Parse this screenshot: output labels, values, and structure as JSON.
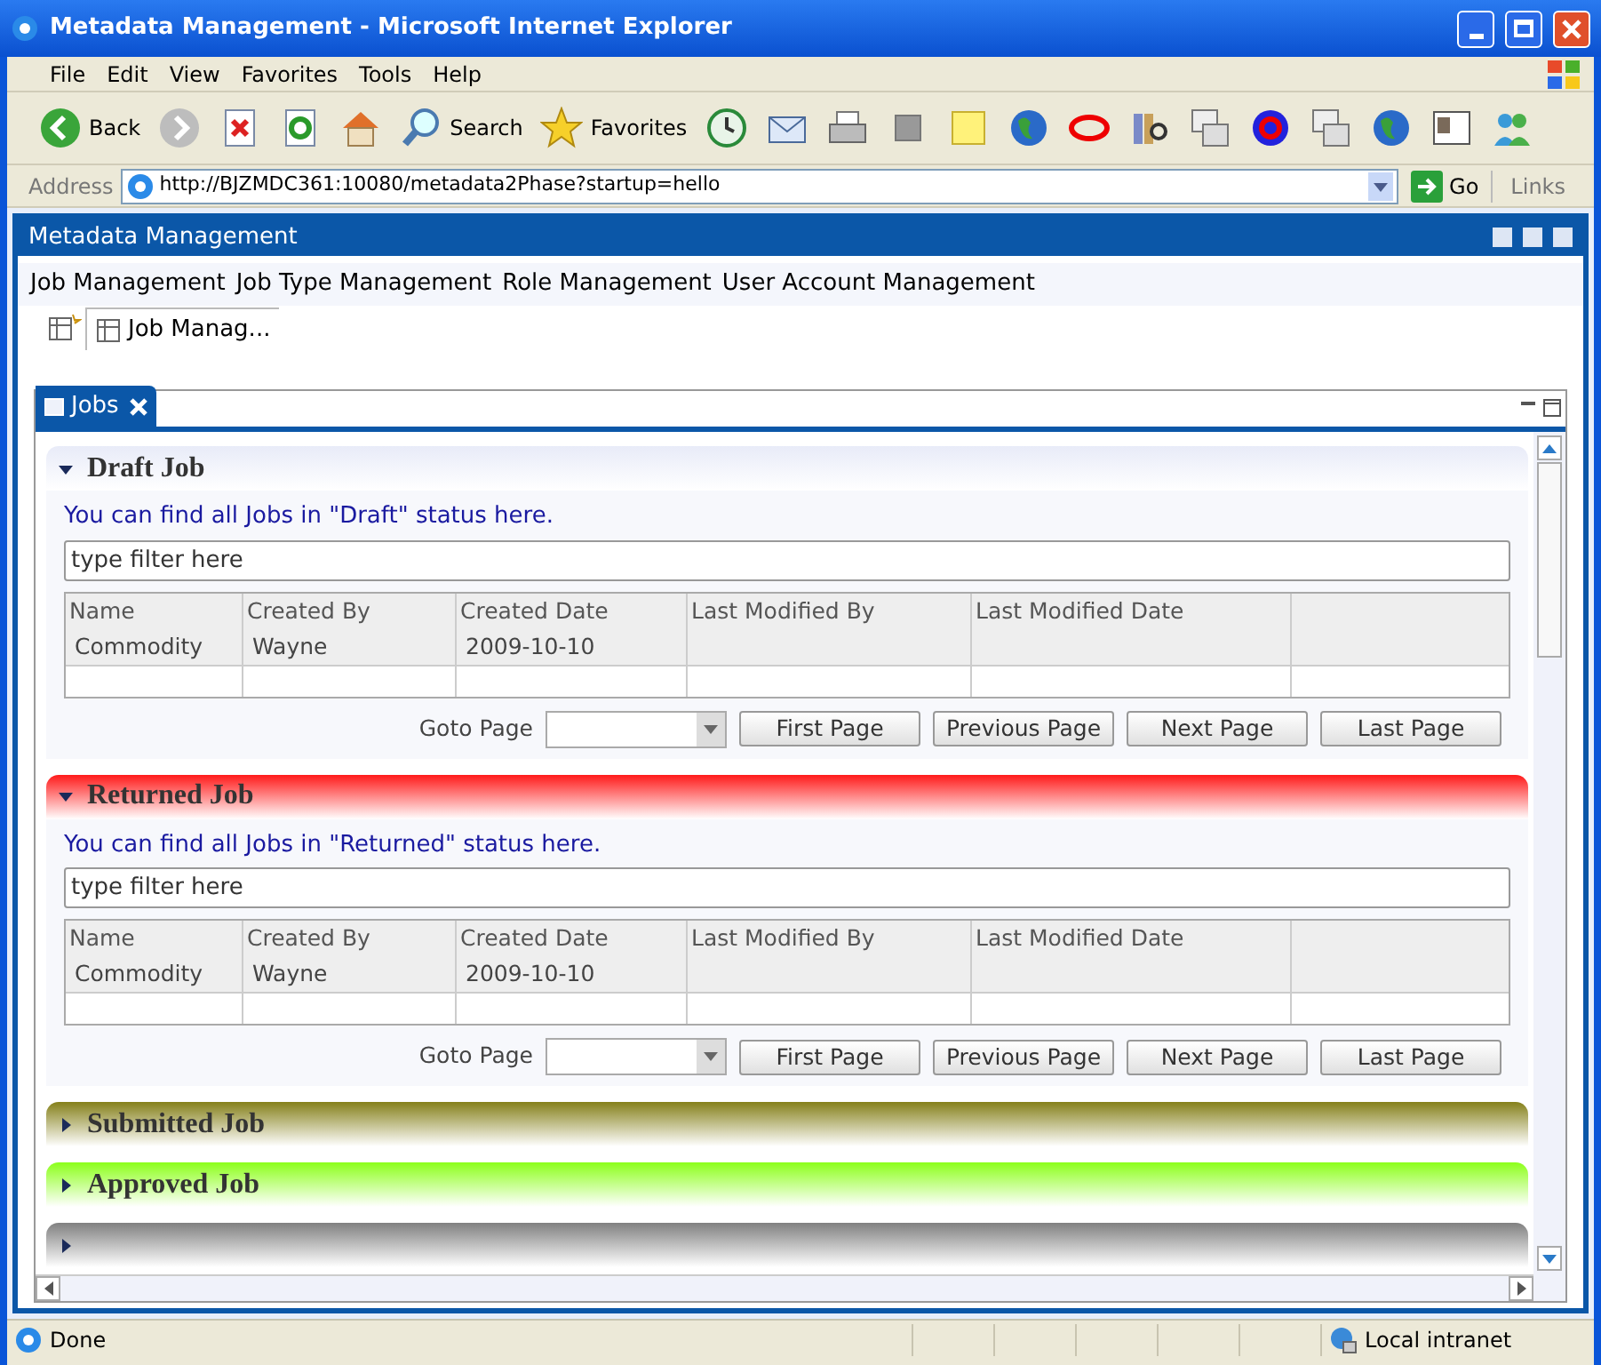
{
  "window": {
    "title": "Metadata Management - Microsoft Internet Explorer"
  },
  "menu": [
    "File",
    "Edit",
    "View",
    "Favorites",
    "Tools",
    "Help"
  ],
  "toolbar": [
    {
      "kind": "back",
      "label": "Back"
    },
    {
      "kind": "forward"
    },
    {
      "kind": "stop"
    },
    {
      "kind": "refresh"
    },
    {
      "kind": "home"
    },
    {
      "kind": "search",
      "label": "Search"
    },
    {
      "kind": "favorites",
      "label": "Favorites"
    },
    {
      "kind": "history"
    },
    {
      "kind": "mail"
    },
    {
      "kind": "print"
    },
    {
      "kind": "edit"
    },
    {
      "kind": "note"
    },
    {
      "kind": "globe"
    },
    {
      "kind": "ring"
    },
    {
      "kind": "books"
    },
    {
      "kind": "sort"
    },
    {
      "kind": "letter"
    },
    {
      "kind": "sort"
    },
    {
      "kind": "globe"
    },
    {
      "kind": "card"
    },
    {
      "kind": "people"
    }
  ],
  "address": {
    "label": "Address",
    "url": "http://BJZMDC361:10080/metadata2Phase?startup=hello",
    "go": "Go",
    "links": "Links"
  },
  "app": {
    "title": "Metadata Management",
    "nav": [
      "Job Management",
      "Job Type Management",
      "Role Management",
      "User Account Management"
    ],
    "page_tab": "Job Manag...",
    "panel_tab": "Jobs",
    "sections": [
      {
        "title": "Draft Job",
        "color": "#e8ebf8",
        "expanded": true,
        "description": "You can find all Jobs in \"Draft\" status here.",
        "filter_placeholder": "type filter here",
        "columns": [
          "Name",
          "Created By",
          "Created Date",
          "Last Modified By",
          "Last Modified Date"
        ],
        "rows": [
          [
            "Commodity",
            "Wayne",
            "2009-10-10",
            "",
            ""
          ]
        ],
        "goto": "Goto Page",
        "buttons": [
          "First Page",
          "Previous Page",
          "Next Page",
          "Last Page"
        ]
      },
      {
        "title": "Returned Job",
        "color": "#ff1a1a",
        "expanded": true,
        "description": "You can find all Jobs in \"Returned\" status here.",
        "filter_placeholder": "type filter here",
        "columns": [
          "Name",
          "Created By",
          "Created Date",
          "Last Modified By",
          "Last Modified Date"
        ],
        "rows": [
          [
            "Commodity",
            "Wayne",
            "2009-10-10",
            "",
            ""
          ]
        ],
        "goto": "Goto Page",
        "buttons": [
          "First Page",
          "Previous Page",
          "Next Page",
          "Last Page"
        ]
      },
      {
        "title": "Submitted Job",
        "color": "#85801a",
        "expanded": false
      },
      {
        "title": "Approved Job",
        "color": "#8cff1a",
        "expanded": false
      },
      {
        "color": "#808080",
        "expanded": false
      }
    ]
  },
  "status_bar": {
    "text": "Done",
    "zone": "Local intranet"
  }
}
